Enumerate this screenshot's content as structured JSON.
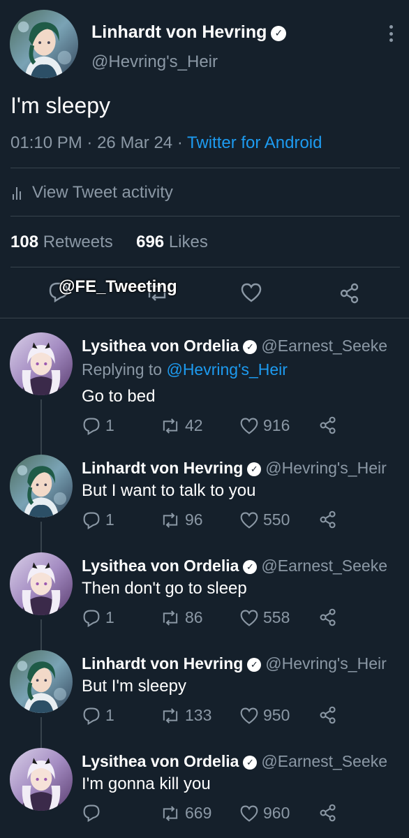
{
  "main_tweet": {
    "author_name": "Linhardt von Hevring",
    "author_handle": "@Hevring's_Heir",
    "text": "I'm sleepy",
    "time": "01:10 PM",
    "date": "26 Mar 24",
    "source": "Twitter for Android",
    "activity_label": "View Tweet activity",
    "retweets_count": "108",
    "retweets_label": "Retweets",
    "likes_count": "696",
    "likes_label": "Likes",
    "watermark": "@FE_Tweeting"
  },
  "replies": [
    {
      "name": "Lysithea von Ordelia",
      "handle": "@Earnest_Seeke",
      "replying_prefix": "Replying to",
      "replying_to": "@Hevring's_Heir",
      "text": "Go to bed",
      "replies": "1",
      "retweets": "42",
      "likes": "916"
    },
    {
      "name": "Linhardt von Hevring",
      "handle": "@Hevring's_Heir",
      "text": "But I want to talk to you",
      "replies": "1",
      "retweets": "96",
      "likes": "550"
    },
    {
      "name": "Lysithea von Ordelia",
      "handle": "@Earnest_Seeke",
      "text": "Then don't go to sleep",
      "replies": "1",
      "retweets": "86",
      "likes": "558"
    },
    {
      "name": "Linhardt von Hevring",
      "handle": "@Hevring's_Heir",
      "text": "But I'm sleepy",
      "replies": "1",
      "retweets": "133",
      "likes": "950"
    },
    {
      "name": "Lysithea von Ordelia",
      "handle": "@Earnest_Seeke",
      "text": "I'm gonna kill you",
      "replies": "",
      "retweets": "669",
      "likes": "960"
    }
  ],
  "colors": {
    "background": "#15202b",
    "accent": "#1d9bf0",
    "muted": "#8b98a5",
    "divider": "#38444d"
  },
  "icons": [
    "verified-badge-icon",
    "more-vertical-icon",
    "activity-bars-icon",
    "reply-icon",
    "retweet-icon",
    "like-icon",
    "share-icon"
  ]
}
